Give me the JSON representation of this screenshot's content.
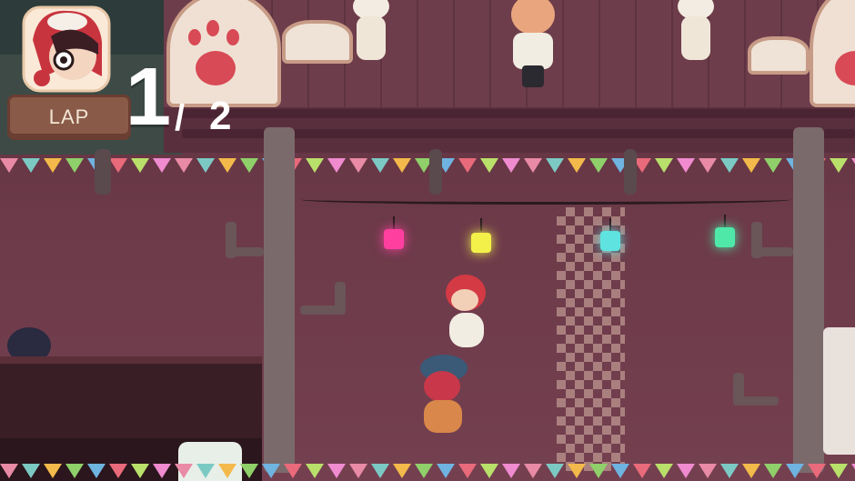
{
  "hud": {
    "lap_label": "LAP",
    "lap_current": "1",
    "lap_separator": "/",
    "lap_total": "2"
  },
  "colors": {
    "lantern_pink": "#ff3fa0",
    "lantern_yellow": "#f3f04a",
    "lantern_cyan": "#5fe3e0",
    "lantern_green": "#4fe8a8",
    "track": "#6c3a49"
  },
  "icons": {
    "portrait": "player-portrait-icon",
    "paw_sign": "paw-print-icon"
  }
}
